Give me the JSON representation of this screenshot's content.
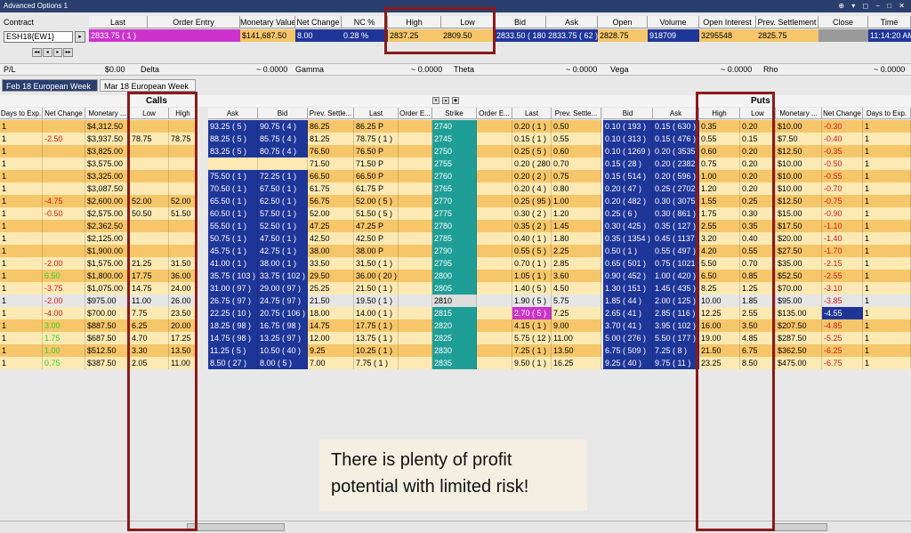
{
  "window": {
    "title": "Advanced Options 1",
    "controls": "⊕ ▾ ◻ − □ ✕"
  },
  "contract": {
    "label": "Contract",
    "value": "ESH18{EW1}"
  },
  "quote": {
    "headers": [
      "Last",
      "Order Entry",
      "Monetary Value",
      "Net Change",
      "NC %",
      "High",
      "Low",
      "Bid",
      "Ask",
      "Open",
      "Volume",
      "Open Interest",
      "Prev. Settlement",
      "Close",
      "Time"
    ],
    "values": {
      "last": "2833.75 ( 1 )",
      "order_entry": "",
      "monetary_value": "$141,687.50",
      "net_change": "8.00",
      "nc_pct": "0.28 %",
      "high": "2837.25",
      "low": "2809.50",
      "bid": "2833.50 ( 180 )",
      "ask": "2833.75 ( 62 )",
      "open": "2828.75",
      "volume": "918709",
      "open_interest": "3295548",
      "prev_settlement": "2825.75",
      "close": "",
      "time": "11:14:20 AM"
    }
  },
  "greeks": {
    "pl_label": "P/L",
    "pl_value": "$0.00",
    "delta_label": "Delta",
    "delta_value": "~ 0.0000",
    "gamma_label": "Gamma",
    "gamma_value": "~ 0.0000",
    "theta_label": "Theta",
    "theta_value": "~ 0.0000",
    "vega_label": "Vega",
    "vega_value": "~ 0.0000",
    "rho_label": "Rho",
    "rho_value": "~ 0.0000"
  },
  "tabs": [
    {
      "label": "Feb 18 European Week 1",
      "active": true
    },
    {
      "label": "Mar 18 European Week 1",
      "active": false
    }
  ],
  "sections": {
    "calls": "Calls",
    "puts": "Puts"
  },
  "columns": [
    "Days to Exp.",
    "Net Change",
    "Monetary ...",
    "Low",
    "High",
    "Ask",
    "Bid",
    "Prev. Settle...",
    "Last",
    "Order E...",
    "Strike",
    "Order E...",
    "Last",
    "Prev. Settle...",
    "Bid",
    "Ask",
    "High",
    "Low",
    "Monetary ...",
    "Net Change",
    "Days to Exp."
  ],
  "rows": [
    {
      "d": "1",
      "nc": "",
      "mv": "$4,312.50",
      "lo": "",
      "hi": "",
      "ca": "93.25 ( 5 )",
      "cb": "90.75 ( 4 )",
      "ps": "86.25",
      "cl": "86.25 P",
      "k": "2740",
      "pl": "0.20 ( 1 )",
      "pps": "0.50",
      "pb": "0.10 ( 193 )",
      "pa": "0.15 ( 630 )",
      "ph": "0.35",
      "plo": "0.20",
      "pmv": "$10.00",
      "pnc": "-0.30",
      "pd": "1"
    },
    {
      "d": "1",
      "nc": "-2.50",
      "mv": "$3,937.50",
      "lo": "78.75",
      "hi": "78.75",
      "ca": "88.25 ( 5 )",
      "cb": "85.75 ( 4 )",
      "ps": "81.25",
      "cl": "78.75 ( 1 )",
      "k": "2745",
      "pl": "0.15 ( 1 )",
      "pps": "0.55",
      "pb": "0.10 ( 313 )",
      "pa": "0.15 ( 476 )",
      "ph": "0.55",
      "plo": "0.15",
      "pmv": "$7.50",
      "pnc": "-0.40",
      "pd": "1"
    },
    {
      "d": "1",
      "nc": "",
      "mv": "$3,825.00",
      "lo": "",
      "hi": "",
      "ca": "83.25 ( 5 )",
      "cb": "80.75 ( 4 )",
      "ps": "76.50",
      "cl": "76.50 P",
      "k": "2750",
      "pl": "0.25 ( 5 )",
      "pps": "0.60",
      "pb": "0.10 ( 1269 )",
      "pa": "0.20 ( 3535 )",
      "ph": "0.60",
      "plo": "0.20",
      "pmv": "$12.50",
      "pnc": "-0.35",
      "pd": "1"
    },
    {
      "d": "1",
      "nc": "",
      "mv": "$3,575.00",
      "lo": "",
      "hi": "",
      "ca": "",
      "cb": "",
      "ps": "71.50",
      "cl": "71.50 P",
      "k": "2755",
      "pl": "0.20 ( 280 )",
      "pps": "0.70",
      "pb": "0.15 ( 28 )",
      "pa": "0.20 ( 2382 )",
      "ph": "0.75",
      "plo": "0.20",
      "pmv": "$10.00",
      "pnc": "-0.50",
      "pd": "1"
    },
    {
      "d": "1",
      "nc": "",
      "mv": "$3,325.00",
      "lo": "",
      "hi": "",
      "ca": "75.50 ( 1 )",
      "cb": "72.25 ( 1 )",
      "ps": "66.50",
      "cl": "66.50 P",
      "k": "2760",
      "pl": "0.20 ( 2 )",
      "pps": "0.75",
      "pb": "0.15 ( 514 )",
      "pa": "0.20 ( 596 )",
      "ph": "1.00",
      "plo": "0.20",
      "pmv": "$10.00",
      "pnc": "-0.55",
      "pd": "1"
    },
    {
      "d": "1",
      "nc": "",
      "mv": "$3,087.50",
      "lo": "",
      "hi": "",
      "ca": "70.50 ( 1 )",
      "cb": "67.50 ( 1 )",
      "ps": "61.75",
      "cl": "61.75 P",
      "k": "2765",
      "pl": "0.20 ( 4 )",
      "pps": "0.80",
      "pb": "0.20 ( 47 )",
      "pa": "0.25 ( 2702 )",
      "ph": "1.20",
      "plo": "0.20",
      "pmv": "$10.00",
      "pnc": "-0.70",
      "pd": "1"
    },
    {
      "d": "1",
      "nc": "-4.75",
      "mv": "$2,600.00",
      "lo": "52.00",
      "hi": "52.00",
      "ca": "65.50 ( 1 )",
      "cb": "62.50 ( 1 )",
      "ps": "56.75",
      "cl": "52.00 ( 5 )",
      "k": "2770",
      "pl": "0.25 ( 95 )",
      "pps": "1.00",
      "pb": "0.20 ( 482 )",
      "pa": "0.30 ( 3075 )",
      "ph": "1.55",
      "plo": "0.25",
      "pmv": "$12.50",
      "pnc": "-0.75",
      "pd": "1"
    },
    {
      "d": "1",
      "nc": "-0.50",
      "mv": "$2,575.00",
      "lo": "50.50",
      "hi": "51.50",
      "ca": "60.50 ( 1 )",
      "cb": "57.50 ( 1 )",
      "ps": "52.00",
      "cl": "51.50 ( 5 )",
      "k": "2775",
      "pl": "0.30 ( 2 )",
      "pps": "1.20",
      "pb": "0.25 ( 6 )",
      "pa": "0.30 ( 861 )",
      "ph": "1.75",
      "plo": "0.30",
      "pmv": "$15.00",
      "pnc": "-0.90",
      "pd": "1"
    },
    {
      "d": "1",
      "nc": "",
      "mv": "$2,362.50",
      "lo": "",
      "hi": "",
      "ca": "55.50 ( 1 )",
      "cb": "52.50 ( 1 )",
      "ps": "47.25",
      "cl": "47.25 P",
      "k": "2780",
      "pl": "0.35 ( 2 )",
      "pps": "1.45",
      "pb": "0.30 ( 425 )",
      "pa": "0.35 ( 127 )",
      "ph": "2.55",
      "plo": "0.35",
      "pmv": "$17.50",
      "pnc": "-1.10",
      "pd": "1"
    },
    {
      "d": "1",
      "nc": "",
      "mv": "$2,125.00",
      "lo": "",
      "hi": "",
      "ca": "50.75 ( 1 )",
      "cb": "47.50 ( 1 )",
      "ps": "42.50",
      "cl": "42.50 P",
      "k": "2785",
      "pl": "0.40 ( 1 )",
      "pps": "1.80",
      "pb": "0.35 ( 1354 )",
      "pa": "0.45 ( 1137 )",
      "ph": "3.20",
      "plo": "0.40",
      "pmv": "$20.00",
      "pnc": "-1.40",
      "pd": "1"
    },
    {
      "d": "1",
      "nc": "",
      "mv": "$1,900.00",
      "lo": "",
      "hi": "",
      "ca": "45.75 ( 1 )",
      "cb": "42.75 ( 1 )",
      "ps": "38.00",
      "cl": "38.00 P",
      "k": "2790",
      "pl": "0.55 ( 5 )",
      "pps": "2.25",
      "pb": "0.50 ( 1 )",
      "pa": "0.55 ( 497 )",
      "ph": "4.20",
      "plo": "0.55",
      "pmv": "$27.50",
      "pnc": "-1.70",
      "pd": "1"
    },
    {
      "d": "1",
      "nc": "-2.00",
      "mv": "$1,575.00",
      "lo": "21.25",
      "hi": "31.50",
      "ca": "41.00 ( 1 )",
      "cb": "38.00 ( 1 )",
      "ps": "33.50",
      "cl": "31.50 ( 1 )",
      "k": "2795",
      "pl": "0.70 ( 1 )",
      "pps": "2.85",
      "pb": "0.65 ( 501 )",
      "pa": "0.75 ( 1021 )",
      "ph": "5.50",
      "plo": "0.70",
      "pmv": "$35.00",
      "pnc": "-2.15",
      "pd": "1"
    },
    {
      "d": "1",
      "nc": "6.50",
      "mv": "$1,800.00",
      "lo": "17.75",
      "hi": "36.00",
      "ca": "35.75 ( 103 )",
      "cb": "33.75 ( 102 )",
      "ps": "29.50",
      "cl": "36.00 ( 20 )",
      "k": "2800",
      "pl": "1.05 ( 1 )",
      "pps": "3.60",
      "pb": "0.90 ( 452 )",
      "pa": "1.00 ( 420 )",
      "ph": "6.50",
      "plo": "0.85",
      "pmv": "$52.50",
      "pnc": "-2.55",
      "pd": "1"
    },
    {
      "d": "1",
      "nc": "-3.75",
      "mv": "$1,075.00",
      "lo": "14.75",
      "hi": "24.00",
      "ca": "31.00 ( 97 )",
      "cb": "29.00 ( 97 )",
      "ps": "25.25",
      "cl": "21.50 ( 1 )",
      "k": "2805",
      "pl": "1.40 ( 5 )",
      "pps": "4.50",
      "pb": "1.30 ( 151 )",
      "pa": "1.45 ( 435 )",
      "ph": "8.25",
      "plo": "1.25",
      "pmv": "$70.00",
      "pnc": "-3.10",
      "pd": "1"
    },
    {
      "d": "1",
      "nc": "-2.00",
      "mv": "$975.00",
      "lo": "11.00",
      "hi": "26.00",
      "ca": "26.75 ( 97 )",
      "cb": "24.75 ( 97 )",
      "ps": "21.50",
      "cl": "19.50 ( 1 )",
      "k": "2810",
      "pl": "1.90 ( 5 )",
      "pps": "5.75",
      "pb": "1.85 ( 44 )",
      "pa": "2.00 ( 125 )",
      "ph": "10.00",
      "plo": "1.85",
      "pmv": "$95.00",
      "pnc": "-3.85",
      "pd": "1",
      "atm": true
    },
    {
      "d": "1",
      "nc": "-4.00",
      "mv": "$700.00",
      "lo": "7.75",
      "hi": "23.50",
      "ca": "22.25 ( 10 )",
      "cb": "20.75 ( 106 )",
      "ps": "18.00",
      "cl": "14.00 ( 1 )",
      "k": "2815",
      "pl": "2.70 ( 5 )",
      "pps": "7.25",
      "pb": "2.65 ( 41 )",
      "pa": "2.85 ( 116 )",
      "ph": "12.25",
      "plo": "2.55",
      "pmv": "$135.00",
      "pnc": "-4.55",
      "pd": "1"
    },
    {
      "d": "1",
      "nc": "3.00",
      "mv": "$887.50",
      "lo": "6.25",
      "hi": "20.00",
      "ca": "18.25 ( 98 )",
      "cb": "16.75 ( 98 )",
      "ps": "14.75",
      "cl": "17.75 ( 1 )",
      "k": "2820",
      "pl": "4.15 ( 1 )",
      "pps": "9.00",
      "pb": "3.70 ( 41 )",
      "pa": "3.95 ( 102 )",
      "ph": "16.00",
      "plo": "3.50",
      "pmv": "$207.50",
      "pnc": "-4.85",
      "pd": "1"
    },
    {
      "d": "1",
      "nc": "1.75",
      "mv": "$687.50",
      "lo": "4.70",
      "hi": "17.25",
      "ca": "14.75 ( 98 )",
      "cb": "13.25 ( 97 )",
      "ps": "12.00",
      "cl": "13.75 ( 1 )",
      "k": "2825",
      "pl": "5.75 ( 12 )",
      "pps": "11.00",
      "pb": "5.00 ( 276 )",
      "pa": "5.50 ( 177 )",
      "ph": "19.00",
      "plo": "4.85",
      "pmv": "$287.50",
      "pnc": "-5.25",
      "pd": "1"
    },
    {
      "d": "1",
      "nc": "1.00",
      "mv": "$512.50",
      "lo": "3.30",
      "hi": "13.50",
      "ca": "11.25 ( 5 )",
      "cb": "10.50 ( 40 )",
      "ps": "9.25",
      "cl": "10.25 ( 1 )",
      "k": "2830",
      "pl": "7.25 ( 1 )",
      "pps": "13.50",
      "pb": "6.75 ( 509 )",
      "pa": "7.25 ( 8 )",
      "ph": "21.50",
      "plo": "6.75",
      "pmv": "$362.50",
      "pnc": "-6.25",
      "pd": "1"
    },
    {
      "d": "1",
      "nc": "0.75",
      "mv": "$387.50",
      "lo": "2.05",
      "hi": "11.00",
      "ca": "8.50 ( 27 )",
      "cb": "8.00 ( 5 )",
      "ps": "7.00",
      "cl": "7.75 ( 1 )",
      "k": "2835",
      "pl": "9.50 ( 1 )",
      "pps": "16.25",
      "pb": "9.25 ( 40 )",
      "pa": "9.75 ( 11 )",
      "ph": "23.25",
      "plo": "8.50",
      "pmv": "$475.00",
      "pnc": "-6.75",
      "pd": "1"
    }
  ],
  "annotation": {
    "line1": "There is plenty of profit",
    "line2": "potential with limited risk!"
  }
}
